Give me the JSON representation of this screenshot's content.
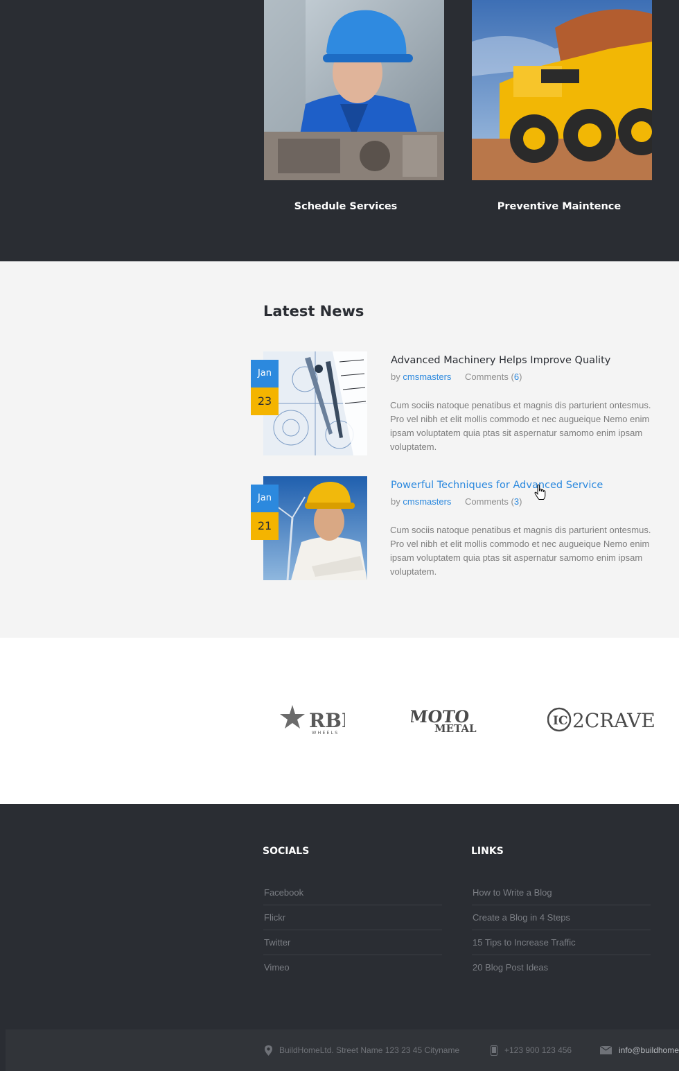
{
  "services": {
    "items": [
      {
        "title": "Schedule Services",
        "image": "engineer-blue-helmet-photo"
      },
      {
        "title": "Preventive Maintence",
        "image": "yellow-dump-truck-photo"
      }
    ]
  },
  "news": {
    "heading": "Latest News",
    "posts": [
      {
        "month": "Jan",
        "day": "23",
        "title": "Advanced Machinery Helps Improve Quality",
        "by": "by",
        "author": "cmsmasters",
        "comments_label": "Comments",
        "comments_count": "6",
        "excerpt": "Cum sociis natoque penatibus et magnis dis parturient ontesmus. Pro vel nibh et elit mollis commodo et nec augueique Nemo enim ipsam voluptatem quia ptas sit aspernatur samomo enim ipsam voluptatem.",
        "image": "blueprint-compass-photo"
      },
      {
        "month": "Jan",
        "day": "21",
        "title": "Powerful Techniques for Advanced Service",
        "by": "by",
        "author": "cmsmasters",
        "comments_label": "Comments",
        "comments_count": "3",
        "excerpt": "Cum sociis natoque penatibus et magnis dis parturient ontesmus. Pro vel nibh et elit mollis commodo et nec augueique Nemo enim ipsam voluptatem quia ptas sit aspernatur samomo enim ipsam voluptatem.",
        "image": "engineer-yellow-helmet-photo"
      }
    ]
  },
  "partners": {
    "logos": [
      {
        "name": "RBP",
        "sub": "WHEELS"
      },
      {
        "name": "MOTO",
        "sub": "METAL"
      },
      {
        "name": "2CRAVE",
        "sub": ""
      }
    ]
  },
  "footer": {
    "socials_heading": "SOCIALS",
    "socials": [
      "Facebook",
      "Flickr",
      "Twitter",
      "Vimeo"
    ],
    "links_heading": "LINKS",
    "links": [
      "How to Write a Blog",
      "Create a Blog in 4 Steps",
      "15 Tips to Increase Traffic",
      "20 Blog Post Ideas"
    ],
    "contact": {
      "address": "BuildHomeLtd.  Street Name 123   23 45 Cityname",
      "phone": "+123 900 123 456",
      "email": "info@buildhome",
      "address_icon": "map-pin-icon",
      "phone_icon": "mobile-phone-icon",
      "email_icon": "envelope-icon"
    }
  },
  "colors": {
    "dark_bg": "#2a2d33",
    "accent_blue": "#2c89de",
    "accent_yellow": "#f4b400",
    "light_bg": "#f4f4f4"
  }
}
